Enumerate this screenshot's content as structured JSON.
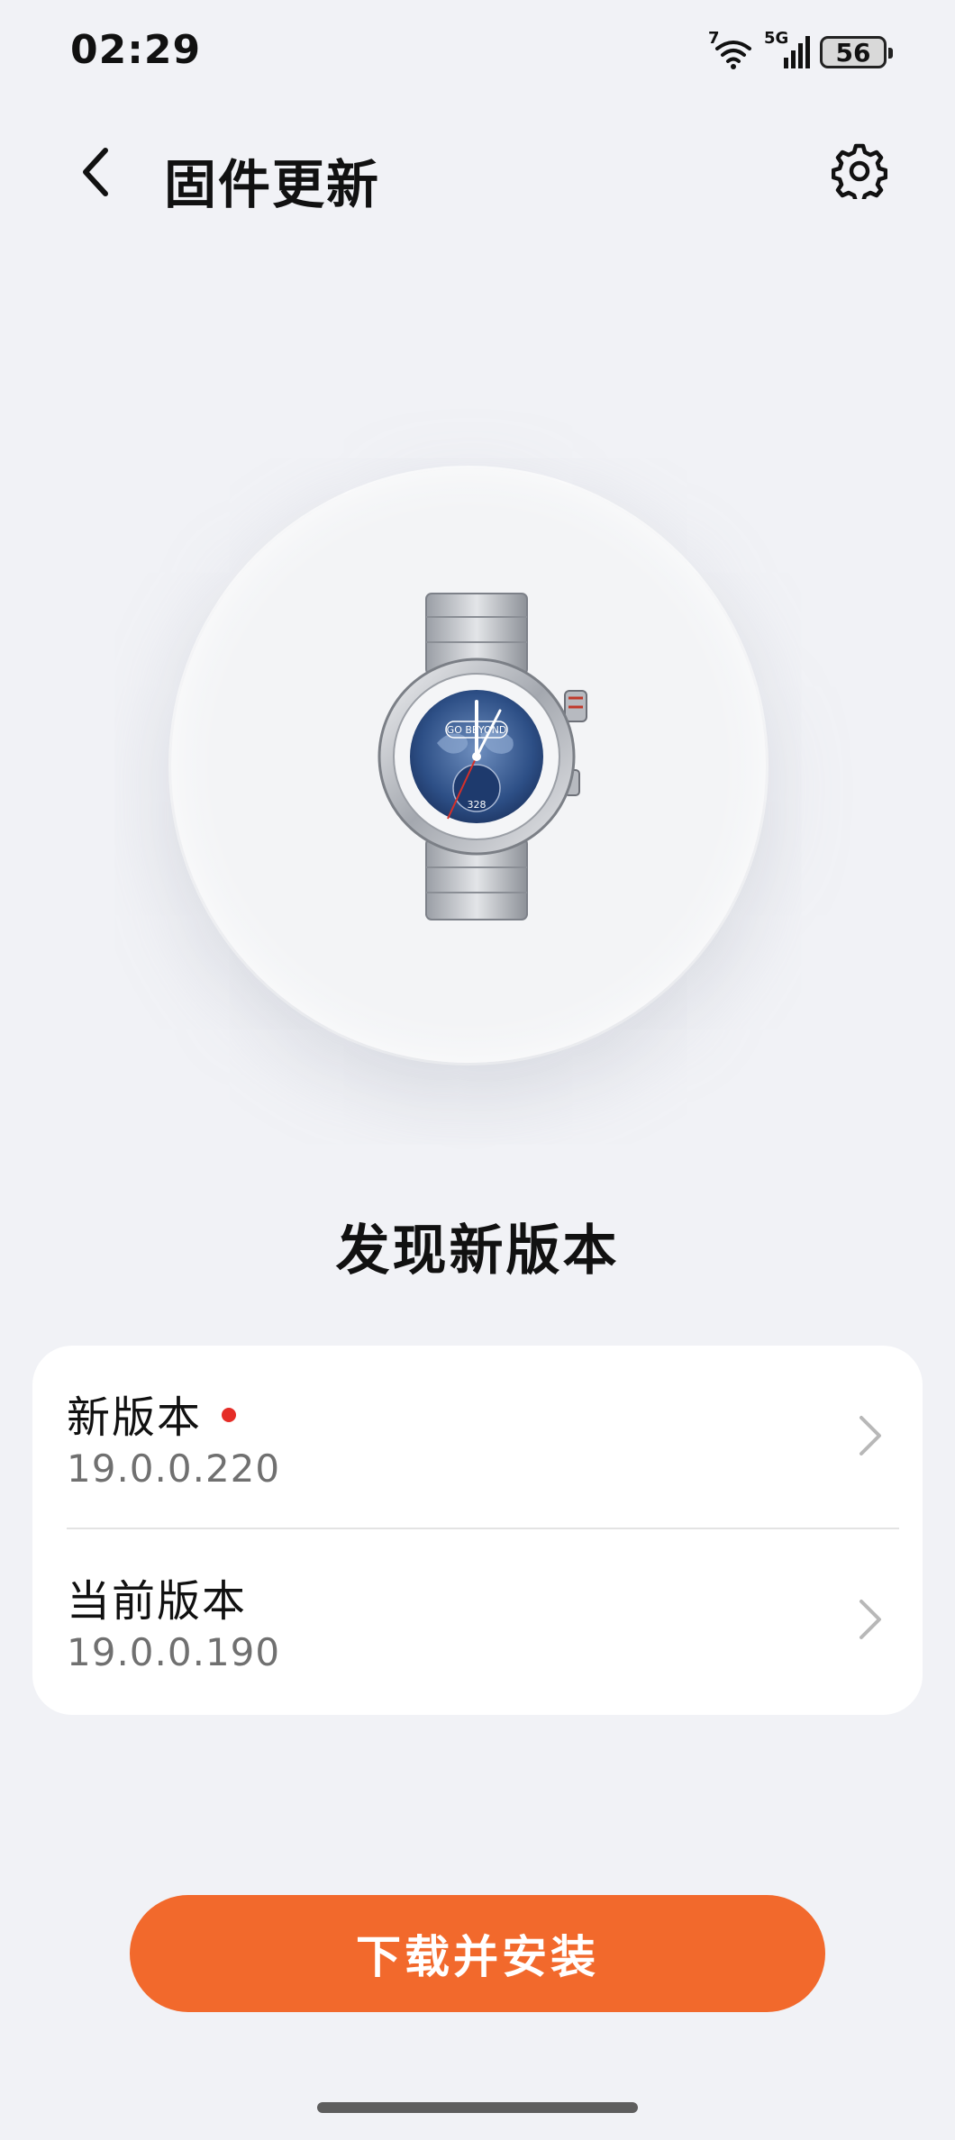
{
  "status_bar": {
    "time": "02:29",
    "signal_sup": "7",
    "network": "5G",
    "battery": "56"
  },
  "header": {
    "title": "固件更新",
    "back_icon": "chevron-left-icon",
    "settings_icon": "gear-icon"
  },
  "device": {
    "face_text": "GO BEYOND",
    "face_number": "328"
  },
  "update_status": "发现新版本",
  "versions": [
    {
      "label": "新版本",
      "value": "19.0.0.220",
      "has_dot": true
    },
    {
      "label": "当前版本",
      "value": "19.0.0.190",
      "has_dot": false
    }
  ],
  "action": {
    "install_label": "下载并安装"
  },
  "colors": {
    "background": "#f1f2f6",
    "accent": "#f2692c",
    "dot": "#e52d27"
  }
}
